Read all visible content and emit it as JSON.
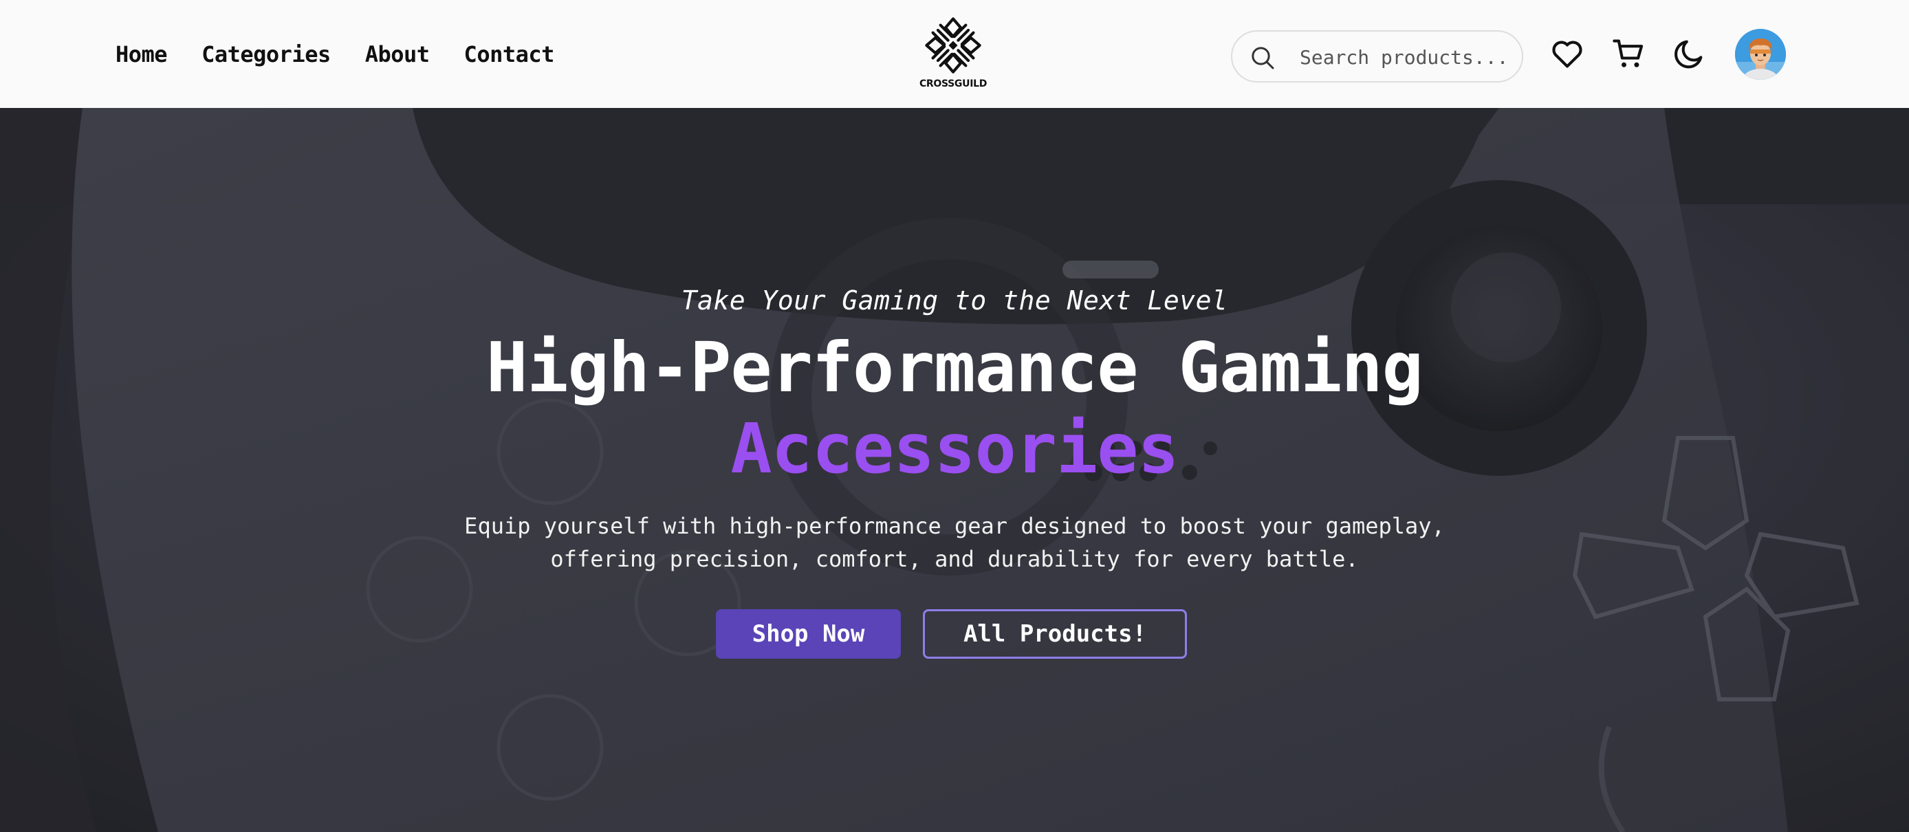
{
  "nav": {
    "links": [
      "Home",
      "Categories",
      "About",
      "Contact"
    ],
    "logo_text": "CROSSGUILD",
    "search": {
      "placeholder": "Search products...",
      "value": ""
    },
    "icons": [
      "heart-icon",
      "cart-icon",
      "moon-icon"
    ],
    "avatar": "user-avatar"
  },
  "hero": {
    "tagline": "Take Your Gaming to the Next Level",
    "title": "High-Performance Gaming",
    "title_accent": "Accessories",
    "description_line1": "Equip yourself with high-performance gear designed to boost your gameplay,",
    "description_line2": "offering precision, comfort, and durability for every battle.",
    "primary_button": "Shop Now",
    "secondary_button": "All Products!",
    "background_image": "game-controller-closeup"
  },
  "colors": {
    "accent_purple": "#9a4ff0",
    "button_primary": "#5a44b8",
    "button_outline_border": "#8e7ee8",
    "nav_background": "#fafafa"
  }
}
